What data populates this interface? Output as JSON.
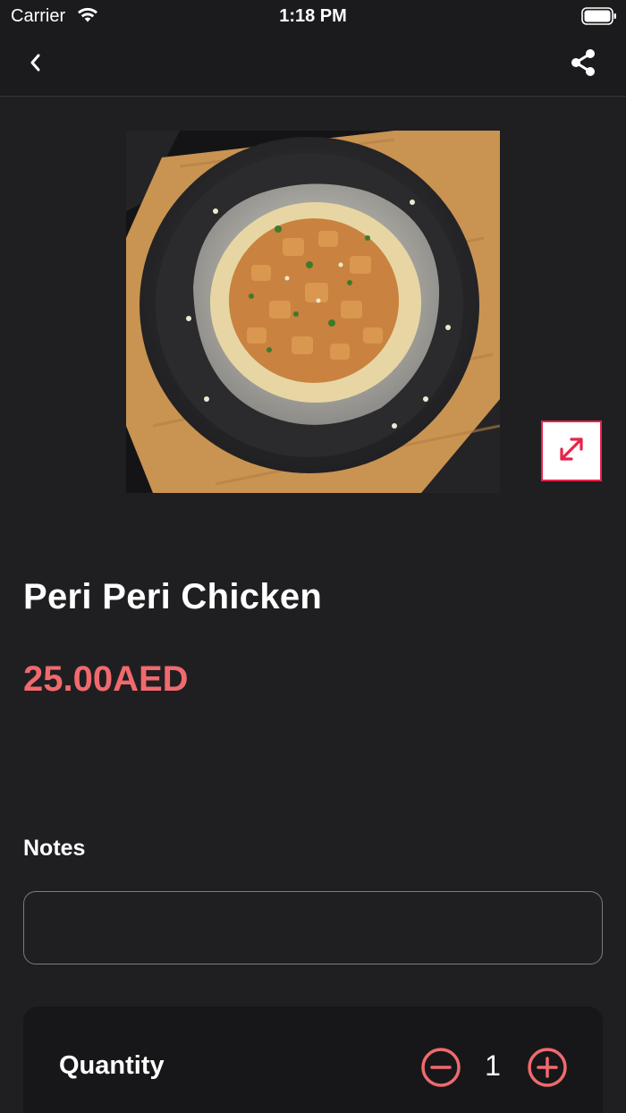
{
  "status_bar": {
    "carrier": "Carrier",
    "time": "1:18 PM"
  },
  "nav": {
    "back_icon": "chevron-left-icon",
    "share_icon": "share-icon"
  },
  "product": {
    "name": "Peri Peri Chicken",
    "price": "25.00AED",
    "image_icon": "expand-icon"
  },
  "notes": {
    "label": "Notes",
    "value": "",
    "placeholder": ""
  },
  "quantity": {
    "label": "Quantity",
    "value": "1",
    "minus_icon": "minus-circle-icon",
    "plus_icon": "plus-circle-icon"
  },
  "colors": {
    "background": "#1f1f22",
    "accent": "#f06a6d",
    "expand_border": "#e8234a"
  }
}
